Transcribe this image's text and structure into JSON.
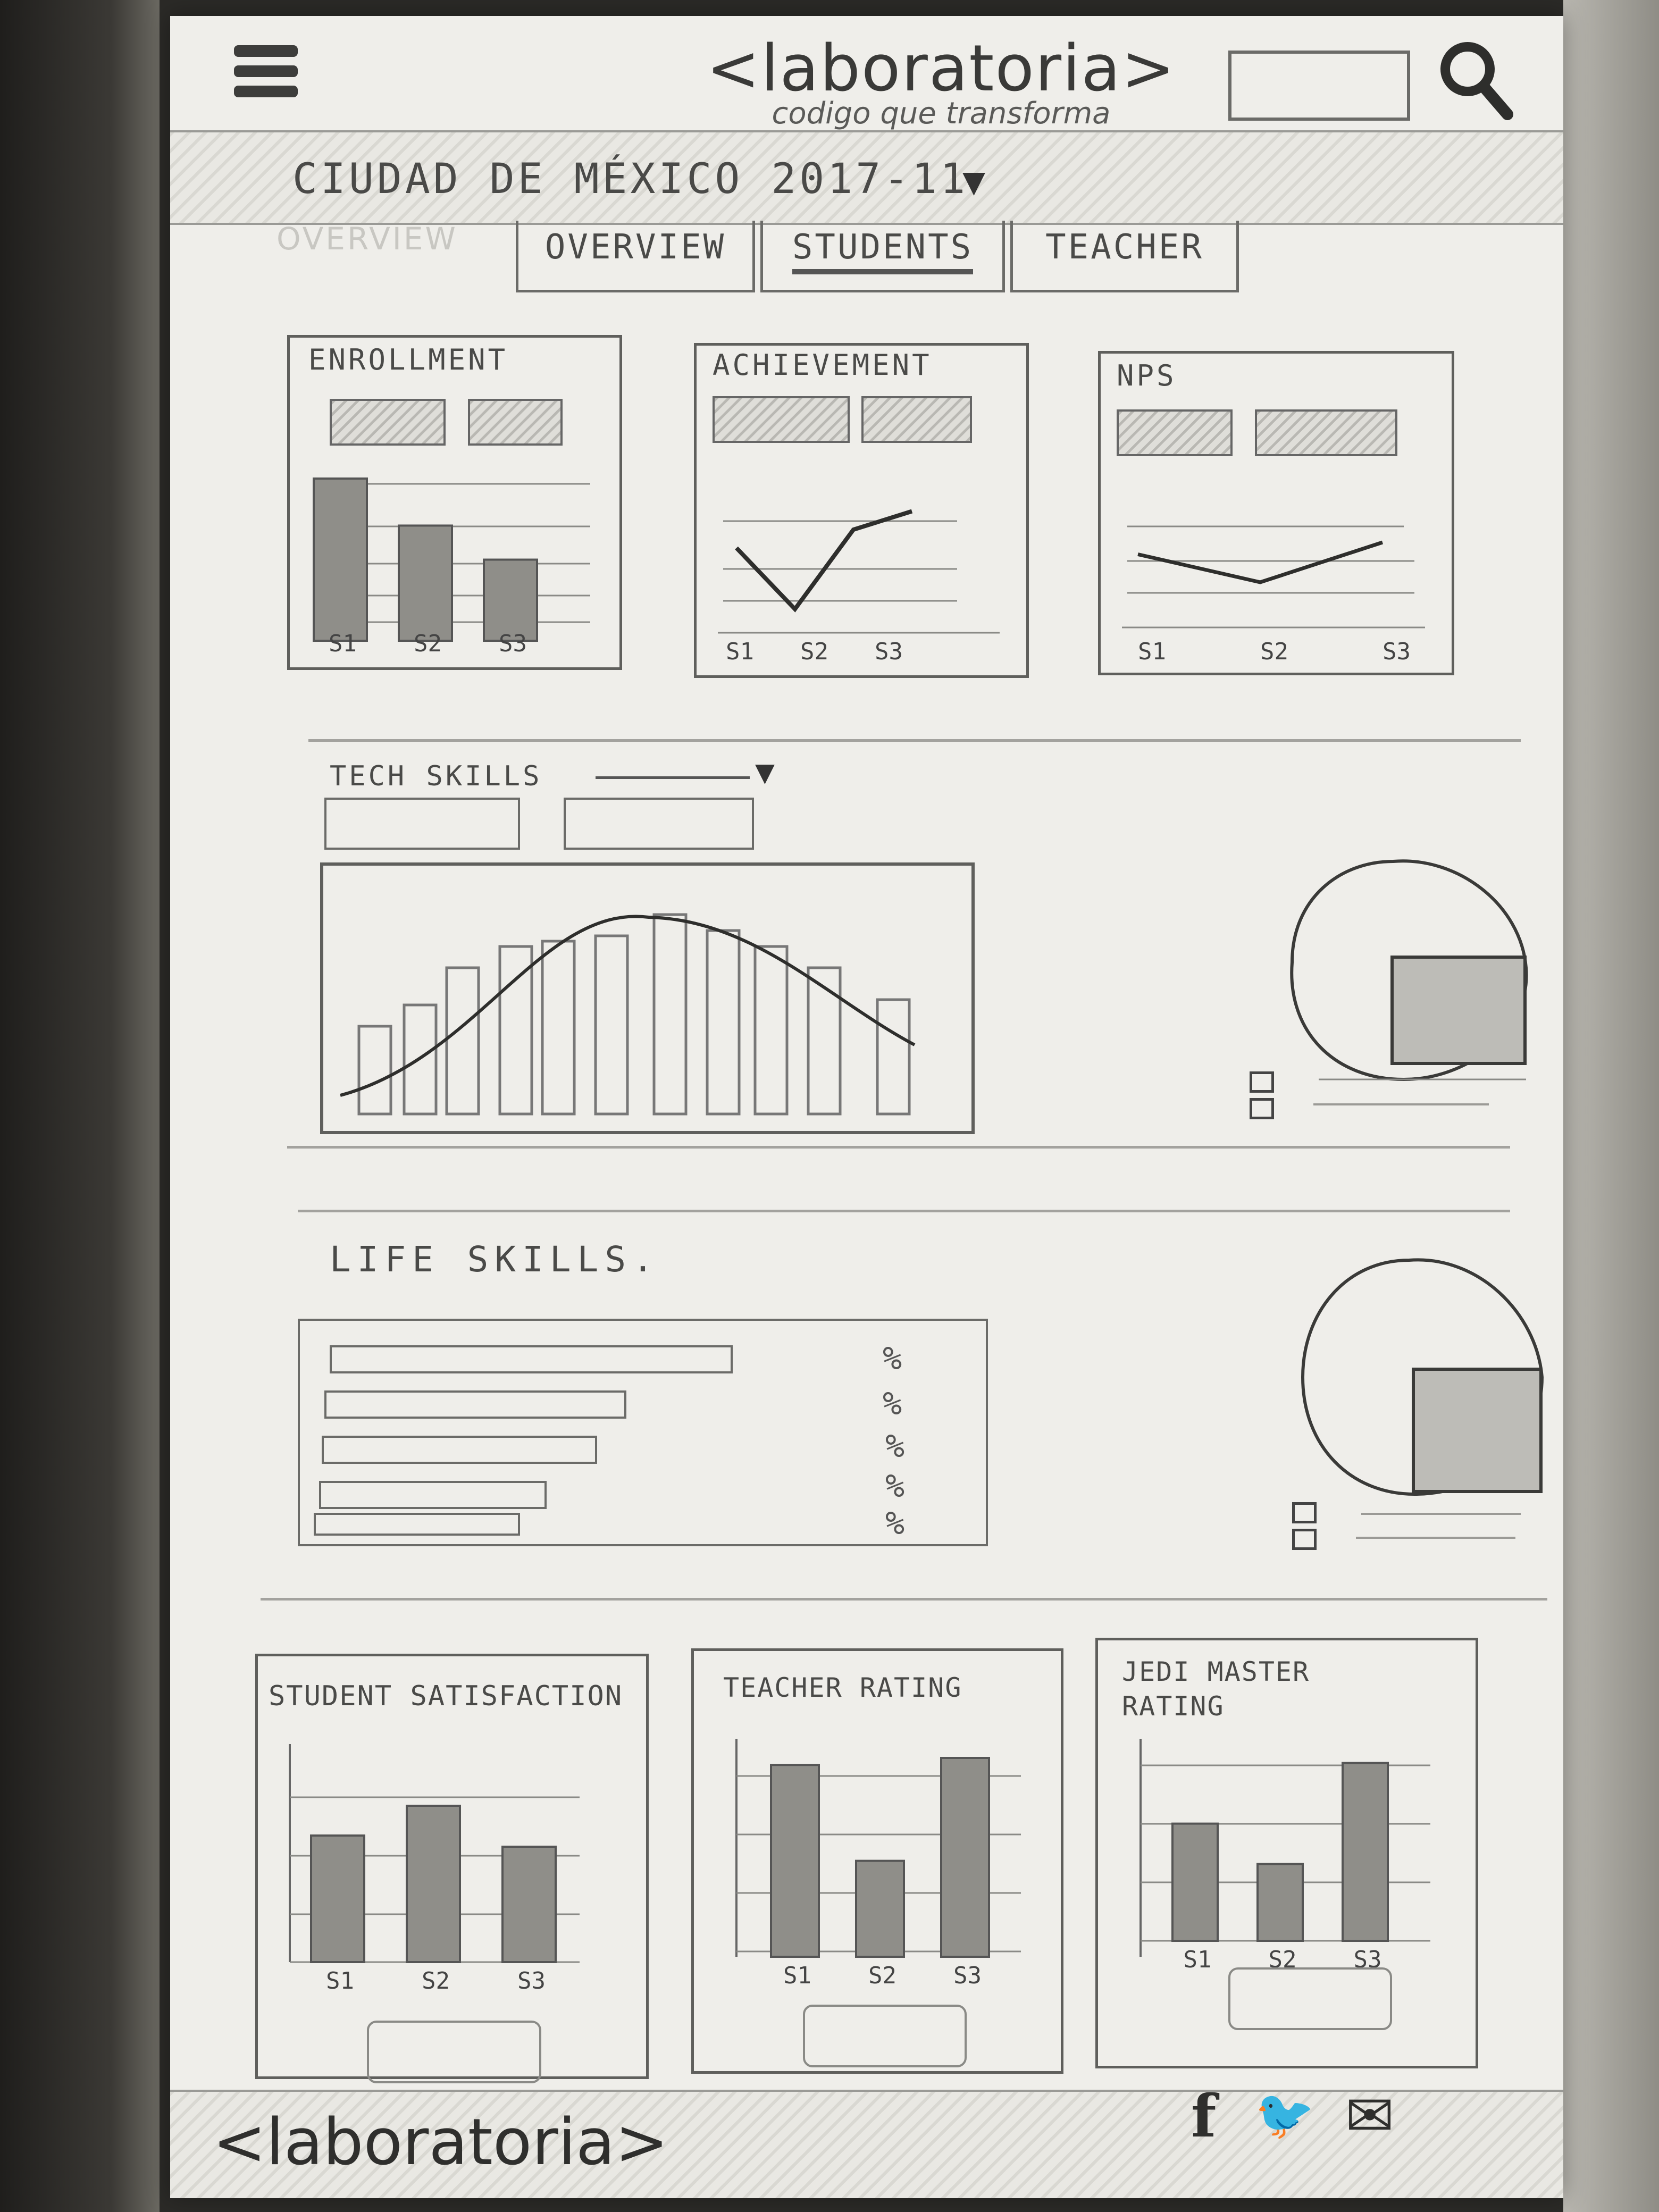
{
  "header": {
    "logo_main": "<laboratoria>",
    "logo_tagline": "codigo que transforma",
    "menu_icon": "hamburger-icon",
    "search_icon": "magnifier-icon"
  },
  "region": {
    "label": "CIUDAD DE MÉXICO  2017-11",
    "caret": "▼"
  },
  "tabs": [
    {
      "label": "OVERVIEW"
    },
    {
      "label": "OVERVIEW"
    },
    {
      "label": "STUDENTS"
    },
    {
      "label": "TEACHER"
    }
  ],
  "cards_top": [
    {
      "title": "ENROLLMENT"
    },
    {
      "title": "ACHIEVEMENT"
    },
    {
      "title": "NPS"
    }
  ],
  "tech_skills": {
    "title": "TECH SKILLS",
    "caret": "▼"
  },
  "life_skills": {
    "title": "LIFE SKILLS.",
    "percent_labels": [
      "%",
      "%",
      "%",
      "%",
      "%"
    ]
  },
  "cards_bottom": [
    {
      "title": "STUDENT SATISFACTION"
    },
    {
      "title": "TEACHER RATING"
    },
    {
      "title_line1": "JEDI MASTER",
      "title_line2": "RATING"
    }
  ],
  "footer": {
    "logo": "<laboratoria>",
    "social": [
      "f",
      "🐦",
      "✉"
    ]
  },
  "chart_data": [
    {
      "type": "bar",
      "categories": [
        "S1",
        "S2",
        "S3"
      ],
      "values": [
        100,
        71,
        50
      ]
    },
    {
      "type": "line",
      "categories": [
        "S1",
        "S2",
        "S3"
      ],
      "values": [
        65,
        15,
        80,
        95
      ]
    },
    {
      "type": "line",
      "categories": [
        "S1",
        "S2",
        "S3"
      ],
      "values": [
        65,
        30,
        80
      ]
    },
    {
      "type": "bar",
      "categories": [
        "S1",
        "S2",
        "S3"
      ],
      "values": [
        68,
        84,
        62
      ]
    },
    {
      "type": "bar",
      "categories": [
        "S1",
        "S2",
        "S3"
      ],
      "values": [
        82,
        41,
        85
      ]
    },
    {
      "type": "bar",
      "categories": [
        "S1",
        "S2",
        "S3"
      ],
      "values": [
        58,
        38,
        88
      ]
    }
  ]
}
